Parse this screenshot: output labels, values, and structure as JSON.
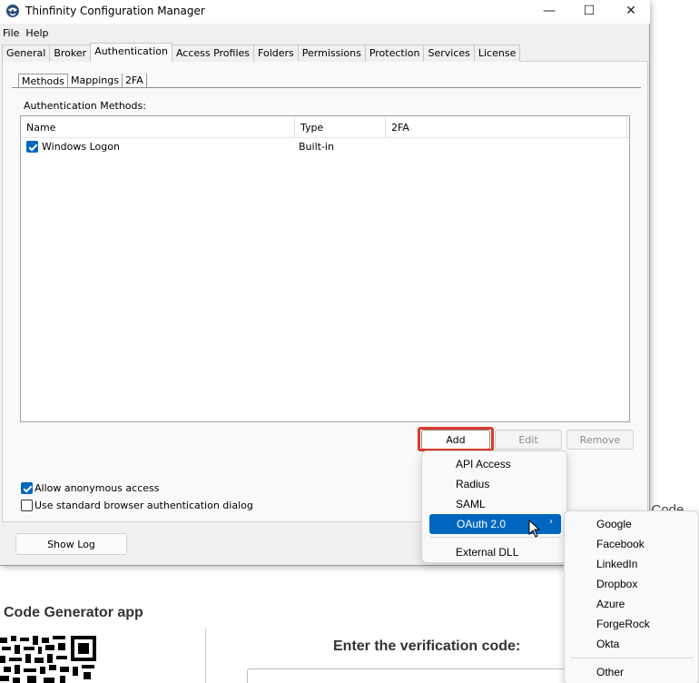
{
  "window": {
    "title": "Thinfinity Configuration Manager",
    "controls": {
      "minimize": "—",
      "maximize": "☐",
      "close": "✕"
    }
  },
  "menubar": {
    "items": [
      "File",
      "Help"
    ]
  },
  "tabs": [
    "General",
    "Broker",
    "Authentication",
    "Access Profiles",
    "Folders",
    "Permissions",
    "Protection",
    "Services",
    "License"
  ],
  "active_tab": "Authentication",
  "subtabs": [
    "Methods",
    "Mappings",
    "2FA"
  ],
  "active_subtab": "Methods",
  "auth": {
    "methods_label": "Authentication Methods:",
    "columns": [
      "Name",
      "Type",
      "2FA"
    ],
    "rows": [
      {
        "name": "Windows Logon",
        "type": "Built-in",
        "twofa": "",
        "checked": true
      }
    ],
    "buttons": {
      "add": "Add",
      "edit": "Edit",
      "remove": "Remove"
    },
    "options": [
      {
        "label": "Allow anonymous access",
        "checked": true
      },
      {
        "label": "Use standard browser authentication dialog",
        "checked": false
      }
    ],
    "show_log": "Show Log"
  },
  "add_menu": {
    "items": [
      "API Access",
      "Radius",
      "SAML",
      "OAuth 2.0",
      "External DLL"
    ],
    "selected": "OAuth 2.0"
  },
  "oauth_menu": {
    "items": [
      "Google",
      "Facebook",
      "LinkedIn",
      "Dropbox",
      "Azure",
      "ForgeRock",
      "Okta",
      "Other"
    ]
  },
  "background_page": {
    "heading": "Code Generator app",
    "verify_label": "Enter the verification code:",
    "partial_text": "n Code"
  },
  "colors": {
    "accent": "#0067c0",
    "highlight": "#e0392a",
    "panel": "#f0f0f0"
  }
}
